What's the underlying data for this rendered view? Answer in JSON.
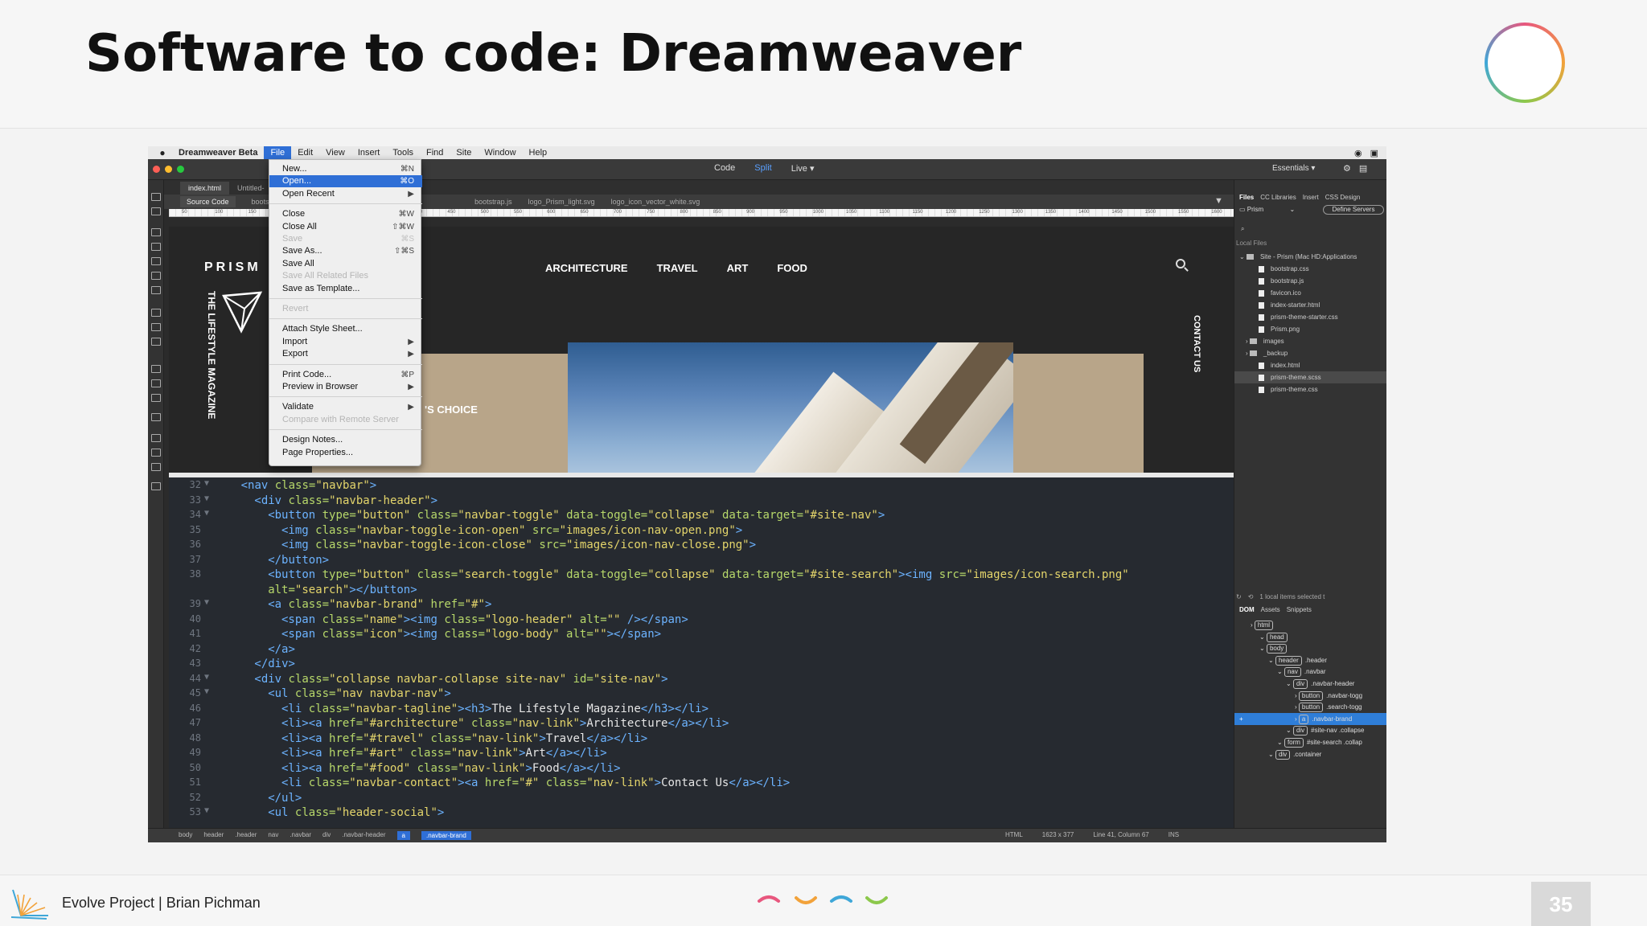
{
  "slide": {
    "title": "Software to code: Dreamweaver",
    "footer": "Evolve Project | Brian Pichman",
    "page": "35"
  },
  "colors": {
    "accent": "#2f6fd6",
    "tag": "#6cb3ff",
    "attr": "#b7d86a",
    "value": "#e4d56b"
  },
  "menubar": {
    "app": "Dreamweaver Beta",
    "items": [
      "File",
      "Edit",
      "View",
      "Insert",
      "Tools",
      "Find",
      "Site",
      "Window",
      "Help"
    ]
  },
  "toolbar": {
    "code": "Code",
    "split": "Split",
    "live": "Live ▾",
    "workspace": "Essentials ▾",
    "settings_icon": "gear-icon"
  },
  "doc_tabs": [
    "index.html",
    "Untitled-"
  ],
  "related_files": [
    "Source Code",
    "bootstrap",
    "bootstrap.js",
    "logo_Prism_light.svg",
    "logo_icon_vector_white.svg"
  ],
  "ruler_marks": [
    "50",
    "100",
    "150",
    "200",
    "250",
    "300",
    "350",
    "400",
    "450",
    "500",
    "550",
    "600",
    "650",
    "700",
    "750",
    "800",
    "850",
    "900",
    "950",
    "1000",
    "1050",
    "1100",
    "1150",
    "1200",
    "1250",
    "1300",
    "1350",
    "1400",
    "1450",
    "1500",
    "1550",
    "1600"
  ],
  "site": {
    "brand": "PRISM",
    "nav": [
      "ARCHITECTURE",
      "TRAVEL",
      "ART",
      "FOOD"
    ],
    "tagline": "THE LIFESTYLE MAGAZINE",
    "contact": "CONTACT US",
    "choice": "'S CHOICE"
  },
  "file_menu": [
    {
      "label": "New...",
      "shortcut": "⌘N"
    },
    {
      "label": "Open...",
      "shortcut": "⌘O",
      "highlight": true
    },
    {
      "label": "Open Recent",
      "shortcut": "▶"
    },
    {
      "sep": true
    },
    {
      "label": "Close",
      "shortcut": "⌘W"
    },
    {
      "label": "Close All",
      "shortcut": "⇧⌘W"
    },
    {
      "label": "Save",
      "shortcut": "⌘S",
      "disabled": true
    },
    {
      "label": "Save As...",
      "shortcut": "⇧⌘S"
    },
    {
      "label": "Save All"
    },
    {
      "label": "Save All Related Files",
      "disabled": true
    },
    {
      "label": "Save as Template..."
    },
    {
      "sep": true
    },
    {
      "label": "Revert",
      "disabled": true
    },
    {
      "sep": true
    },
    {
      "label": "Attach Style Sheet..."
    },
    {
      "label": "Import",
      "shortcut": "▶"
    },
    {
      "label": "Export",
      "shortcut": "▶"
    },
    {
      "sep": true
    },
    {
      "label": "Print Code...",
      "shortcut": "⌘P"
    },
    {
      "label": "Preview in Browser",
      "shortcut": "▶"
    },
    {
      "sep": true
    },
    {
      "label": "Validate",
      "shortcut": "▶"
    },
    {
      "label": "Compare with Remote Server",
      "disabled": true
    },
    {
      "sep": true
    },
    {
      "label": "Design Notes..."
    },
    {
      "label": "Page Properties..."
    }
  ],
  "code_lines": [
    {
      "n": "32",
      "f": "▼",
      "i": 4,
      "t": [
        [
          "t",
          "<nav "
        ],
        [
          "a",
          "class="
        ],
        [
          "v",
          "\"navbar\""
        ],
        [
          "t",
          ">"
        ]
      ]
    },
    {
      "n": "33",
      "f": "▼",
      "i": 6,
      "t": [
        [
          "t",
          "<div "
        ],
        [
          "a",
          "class="
        ],
        [
          "v",
          "\"navbar-header\""
        ],
        [
          "t",
          ">"
        ]
      ]
    },
    {
      "n": "34",
      "f": "▼",
      "i": 8,
      "t": [
        [
          "t",
          "<button "
        ],
        [
          "a",
          "type="
        ],
        [
          "v",
          "\"button\" "
        ],
        [
          "a",
          "class="
        ],
        [
          "v",
          "\"navbar-toggle\" "
        ],
        [
          "a",
          "data-toggle="
        ],
        [
          "v",
          "\"collapse\" "
        ],
        [
          "a",
          "data-target="
        ],
        [
          "v",
          "\"#site-nav\""
        ],
        [
          "t",
          ">"
        ]
      ]
    },
    {
      "n": "35",
      "f": "",
      "i": 10,
      "t": [
        [
          "t",
          "<img "
        ],
        [
          "a",
          "class="
        ],
        [
          "v",
          "\"navbar-toggle-icon-open\" "
        ],
        [
          "a",
          "src="
        ],
        [
          "v",
          "\"images/icon-nav-open.png\""
        ],
        [
          "t",
          ">"
        ]
      ]
    },
    {
      "n": "36",
      "f": "",
      "i": 10,
      "t": [
        [
          "t",
          "<img "
        ],
        [
          "a",
          "class="
        ],
        [
          "v",
          "\"navbar-toggle-icon-close\" "
        ],
        [
          "a",
          "src="
        ],
        [
          "v",
          "\"images/icon-nav-close.png\""
        ],
        [
          "t",
          ">"
        ]
      ]
    },
    {
      "n": "37",
      "f": "",
      "i": 8,
      "t": [
        [
          "t",
          "</button>"
        ]
      ]
    },
    {
      "n": "38",
      "f": "",
      "i": 8,
      "t": [
        [
          "t",
          "<button "
        ],
        [
          "a",
          "type="
        ],
        [
          "v",
          "\"button\" "
        ],
        [
          "a",
          "class="
        ],
        [
          "v",
          "\"search-toggle\" "
        ],
        [
          "a",
          "data-toggle="
        ],
        [
          "v",
          "\"collapse\" "
        ],
        [
          "a",
          "data-target="
        ],
        [
          "v",
          "\"#site-search\""
        ],
        [
          "t",
          "><img "
        ],
        [
          "a",
          "src="
        ],
        [
          "v",
          "\"images/icon-search.png\""
        ]
      ]
    },
    {
      "n": "",
      "f": "",
      "i": 8,
      "t": [
        [
          "a",
          "alt="
        ],
        [
          "v",
          "\"search\""
        ],
        [
          "t",
          "></button>"
        ]
      ]
    },
    {
      "n": "39",
      "f": "▼",
      "i": 8,
      "t": [
        [
          "t",
          "<a "
        ],
        [
          "a",
          "class="
        ],
        [
          "v",
          "\"navbar-brand\" "
        ],
        [
          "a",
          "href="
        ],
        [
          "v",
          "\"#\""
        ],
        [
          "t",
          ">"
        ]
      ]
    },
    {
      "n": "40",
      "f": "",
      "i": 10,
      "t": [
        [
          "t",
          "<span "
        ],
        [
          "a",
          "class="
        ],
        [
          "v",
          "\"name\""
        ],
        [
          "t",
          "><img "
        ],
        [
          "a",
          "class="
        ],
        [
          "v",
          "\"logo-header\" "
        ],
        [
          "a",
          "alt="
        ],
        [
          "v",
          "\"\" "
        ],
        [
          "t",
          "/></span>"
        ]
      ]
    },
    {
      "n": "41",
      "f": "",
      "i": 10,
      "t": [
        [
          "t",
          "<span "
        ],
        [
          "a",
          "class="
        ],
        [
          "v",
          "\"icon\""
        ],
        [
          "t",
          "><img "
        ],
        [
          "a",
          "class="
        ],
        [
          "v",
          "\"logo-body\" "
        ],
        [
          "a",
          "alt="
        ],
        [
          "v",
          "\"\""
        ],
        [
          "t",
          "></span>"
        ]
      ]
    },
    {
      "n": "42",
      "f": "",
      "i": 8,
      "t": [
        [
          "t",
          "</a>"
        ]
      ]
    },
    {
      "n": "43",
      "f": "",
      "i": 6,
      "t": [
        [
          "t",
          "</div>"
        ]
      ]
    },
    {
      "n": "44",
      "f": "▼",
      "i": 6,
      "t": [
        [
          "t",
          "<div "
        ],
        [
          "a",
          "class="
        ],
        [
          "v",
          "\"collapse navbar-collapse site-nav\" "
        ],
        [
          "a",
          "id="
        ],
        [
          "v",
          "\"site-nav\""
        ],
        [
          "t",
          ">"
        ]
      ]
    },
    {
      "n": "45",
      "f": "▼",
      "i": 8,
      "t": [
        [
          "t",
          "<ul "
        ],
        [
          "a",
          "class="
        ],
        [
          "v",
          "\"nav navbar-nav\""
        ],
        [
          "t",
          ">"
        ]
      ]
    },
    {
      "n": "46",
      "f": "",
      "i": 10,
      "t": [
        [
          "t",
          "<li "
        ],
        [
          "a",
          "class="
        ],
        [
          "v",
          "\"navbar-tagline\""
        ],
        [
          "t",
          "><h3>"
        ],
        [
          "x",
          "The Lifestyle Magazine"
        ],
        [
          "t",
          "</h3></li>"
        ]
      ]
    },
    {
      "n": "47",
      "f": "",
      "i": 10,
      "t": [
        [
          "t",
          "<li><a "
        ],
        [
          "a",
          "href="
        ],
        [
          "v",
          "\"#architecture\" "
        ],
        [
          "a",
          "class="
        ],
        [
          "v",
          "\"nav-link\""
        ],
        [
          "t",
          ">"
        ],
        [
          "x",
          "Architecture"
        ],
        [
          "t",
          "</a></li>"
        ]
      ]
    },
    {
      "n": "48",
      "f": "",
      "i": 10,
      "t": [
        [
          "t",
          "<li><a "
        ],
        [
          "a",
          "href="
        ],
        [
          "v",
          "\"#travel\" "
        ],
        [
          "a",
          "class="
        ],
        [
          "v",
          "\"nav-link\""
        ],
        [
          "t",
          ">"
        ],
        [
          "x",
          "Travel"
        ],
        [
          "t",
          "</a></li>"
        ]
      ]
    },
    {
      "n": "49",
      "f": "",
      "i": 10,
      "t": [
        [
          "t",
          "<li><a "
        ],
        [
          "a",
          "href="
        ],
        [
          "v",
          "\"#art\" "
        ],
        [
          "a",
          "class="
        ],
        [
          "v",
          "\"nav-link\""
        ],
        [
          "t",
          ">"
        ],
        [
          "x",
          "Art"
        ],
        [
          "t",
          "</a></li>"
        ]
      ]
    },
    {
      "n": "50",
      "f": "",
      "i": 10,
      "t": [
        [
          "t",
          "<li><a "
        ],
        [
          "a",
          "href="
        ],
        [
          "v",
          "\"#food\" "
        ],
        [
          "a",
          "class="
        ],
        [
          "v",
          "\"nav-link\""
        ],
        [
          "t",
          ">"
        ],
        [
          "x",
          "Food"
        ],
        [
          "t",
          "</a></li>"
        ]
      ]
    },
    {
      "n": "51",
      "f": "",
      "i": 10,
      "t": [
        [
          "t",
          "<li "
        ],
        [
          "a",
          "class="
        ],
        [
          "v",
          "\"navbar-contact\""
        ],
        [
          "t",
          "><a "
        ],
        [
          "a",
          "href="
        ],
        [
          "v",
          "\"#\" "
        ],
        [
          "a",
          "class="
        ],
        [
          "v",
          "\"nav-link\""
        ],
        [
          "t",
          ">"
        ],
        [
          "x",
          "Contact Us"
        ],
        [
          "t",
          "</a></li>"
        ]
      ]
    },
    {
      "n": "52",
      "f": "",
      "i": 8,
      "t": [
        [
          "t",
          "</ul>"
        ]
      ]
    },
    {
      "n": "53",
      "f": "▼",
      "i": 8,
      "t": [
        [
          "t",
          "<ul "
        ],
        [
          "a",
          "class="
        ],
        [
          "v",
          "\"header-social\""
        ],
        [
          "t",
          ">"
        ]
      ]
    }
  ],
  "statusbar": {
    "crumbs": [
      "body",
      "header",
      ".header",
      "nav",
      ".navbar",
      "div",
      ".navbar-header",
      "a",
      ".navbar-brand"
    ],
    "mode": "HTML",
    "size": "1623 x 377",
    "position": "Line 41, Column 67",
    "ins": "INS"
  },
  "files_panel": {
    "tabs": [
      "Files",
      "CC Libraries",
      "Insert",
      "CSS Design"
    ],
    "site": "Prism",
    "define": "Define Servers",
    "local_label": "Local Files",
    "root": "Site - Prism (Mac HD:Applications",
    "items": [
      {
        "name": "bootstrap.css",
        "type": "file"
      },
      {
        "name": "bootstrap.js",
        "type": "file"
      },
      {
        "name": "favicon.ico",
        "type": "file"
      },
      {
        "name": "index-starter.html",
        "type": "file"
      },
      {
        "name": "prism-theme-starter.css",
        "type": "file"
      },
      {
        "name": "Prism.png",
        "type": "file"
      },
      {
        "name": "images",
        "type": "folder"
      },
      {
        "name": "_backup",
        "type": "folder"
      },
      {
        "name": "index.html",
        "type": "file"
      },
      {
        "name": "prism-theme.scss",
        "type": "file",
        "selected": true
      },
      {
        "name": "prism-theme.css",
        "type": "file"
      }
    ],
    "selected_info": "1 local items selected t"
  },
  "dom_panel": {
    "tabs": [
      "DOM",
      "Assets",
      "Snippets"
    ],
    "nodes": [
      {
        "tag": "html",
        "cls": "",
        "depth": 0
      },
      {
        "tag": "head",
        "cls": "",
        "depth": 1
      },
      {
        "tag": "body",
        "cls": "",
        "depth": 1
      },
      {
        "tag": "header",
        "cls": ".header",
        "depth": 2
      },
      {
        "tag": "nav",
        "cls": ".navbar",
        "depth": 3
      },
      {
        "tag": "div",
        "cls": ".navbar-header",
        "depth": 4
      },
      {
        "tag": "button",
        "cls": ".navbar-togg",
        "depth": 5
      },
      {
        "tag": "button",
        "cls": ".search-togg",
        "depth": 5
      },
      {
        "tag": "a",
        "cls": ".navbar-brand",
        "depth": 5,
        "selected": true
      },
      {
        "tag": "div",
        "cls": "#site-nav .collapse",
        "depth": 4
      },
      {
        "tag": "form",
        "cls": "#site-search .collap",
        "depth": 3
      },
      {
        "tag": "div",
        "cls": ".container",
        "depth": 2
      }
    ]
  }
}
